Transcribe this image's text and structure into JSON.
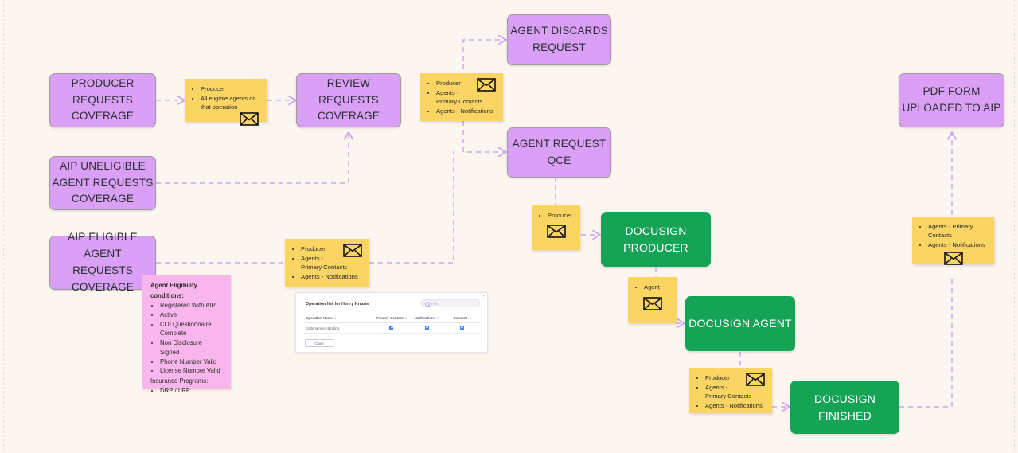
{
  "board": {
    "background_color": "#fdf5ef",
    "connector_color": "#c9a7f2",
    "colors": {
      "process": "#d9a0f5",
      "note": "#fbd563",
      "conditions_note": "#f9b6ec",
      "docusign": "#15a356"
    }
  },
  "nodes": {
    "producer_requests": "PRODUCER\nREQUESTS\nCOVERAGE",
    "producer_requests_lines": [
      "PRODUCER",
      "REQUESTS",
      "COVERAGE"
    ],
    "aip_uneligible_lines": [
      "AIP UNELIGIBLE",
      "AGENT REQUESTS",
      "COVERAGE"
    ],
    "aip_eligible_lines": [
      "AIP ELIGIBLE AGENT",
      "REQUESTS",
      "COVERAGE"
    ],
    "review_requests_lines": [
      "REVIEW REQUESTS",
      "COVERAGE"
    ],
    "agent_discards_lines": [
      "AGENT DISCARDS",
      "REQUEST"
    ],
    "agent_request_qce_lines": [
      "AGENT REQUEST",
      "QCE"
    ],
    "pdf_form_lines": [
      "PDF FORM",
      "UPLOADED TO AIP"
    ],
    "docusign_producer_lines": [
      "DOCUSIGN",
      "PRODUCER"
    ],
    "docusign_agent_lines": [
      "DOCUSIGN AGENT"
    ],
    "docusign_finished_lines": [
      "DOCUSIGN",
      "FINISHED"
    ]
  },
  "notes": {
    "producer_note": {
      "items": [
        "Producer",
        "All eligible agents on that operation"
      ],
      "icon": "envelope-icon"
    },
    "review_note": {
      "items": [
        "Producer",
        "Agents - Primary Contacts",
        "Agents - Notifications"
      ],
      "icon": "envelope-icon"
    },
    "eligible_agent_note": {
      "items": [
        "Producer",
        "Agents - Primary Contacts",
        "Agents - Notifications"
      ],
      "icon": "envelope-icon"
    },
    "qce_producer_note": {
      "items": [
        "Producer"
      ],
      "icon": "envelope-icon"
    },
    "agent_note": {
      "items": [
        "Agent"
      ],
      "icon": "envelope-icon"
    },
    "finished_note": {
      "items": [
        "Producer",
        "Agents - Primary Contacts",
        "Agents - Notifications"
      ],
      "icon": "envelope-icon"
    },
    "pdf_note": {
      "items": [
        "Agents - Primary Contacts",
        "Agents - Notifications"
      ],
      "icon": "envelope-icon"
    }
  },
  "conditions_note": {
    "heading_line1": "Agent Eligibility",
    "heading_line2": "conditions:",
    "items": [
      "Registered With AIP",
      "Active",
      "COI Questionnaire Complete",
      "Non Disclosure Signed",
      "Phone Number Valid",
      "License Number Valid"
    ],
    "subheading": "Insurance Programs:",
    "sub_items": [
      "DRP / LRP"
    ]
  },
  "embedded_screenshot": {
    "title": "Operation list for Henry Krause",
    "search_placeholder": "Find",
    "close_label": "×",
    "columns": [
      "Operation Name",
      "Primary Contact",
      "Notifications",
      "Consent"
    ],
    "rows": [
      {
        "operation_name": "Endorsement Binding",
        "primary_contact": true,
        "notifications": true,
        "consent": true
      }
    ],
    "button_label": "Close"
  }
}
